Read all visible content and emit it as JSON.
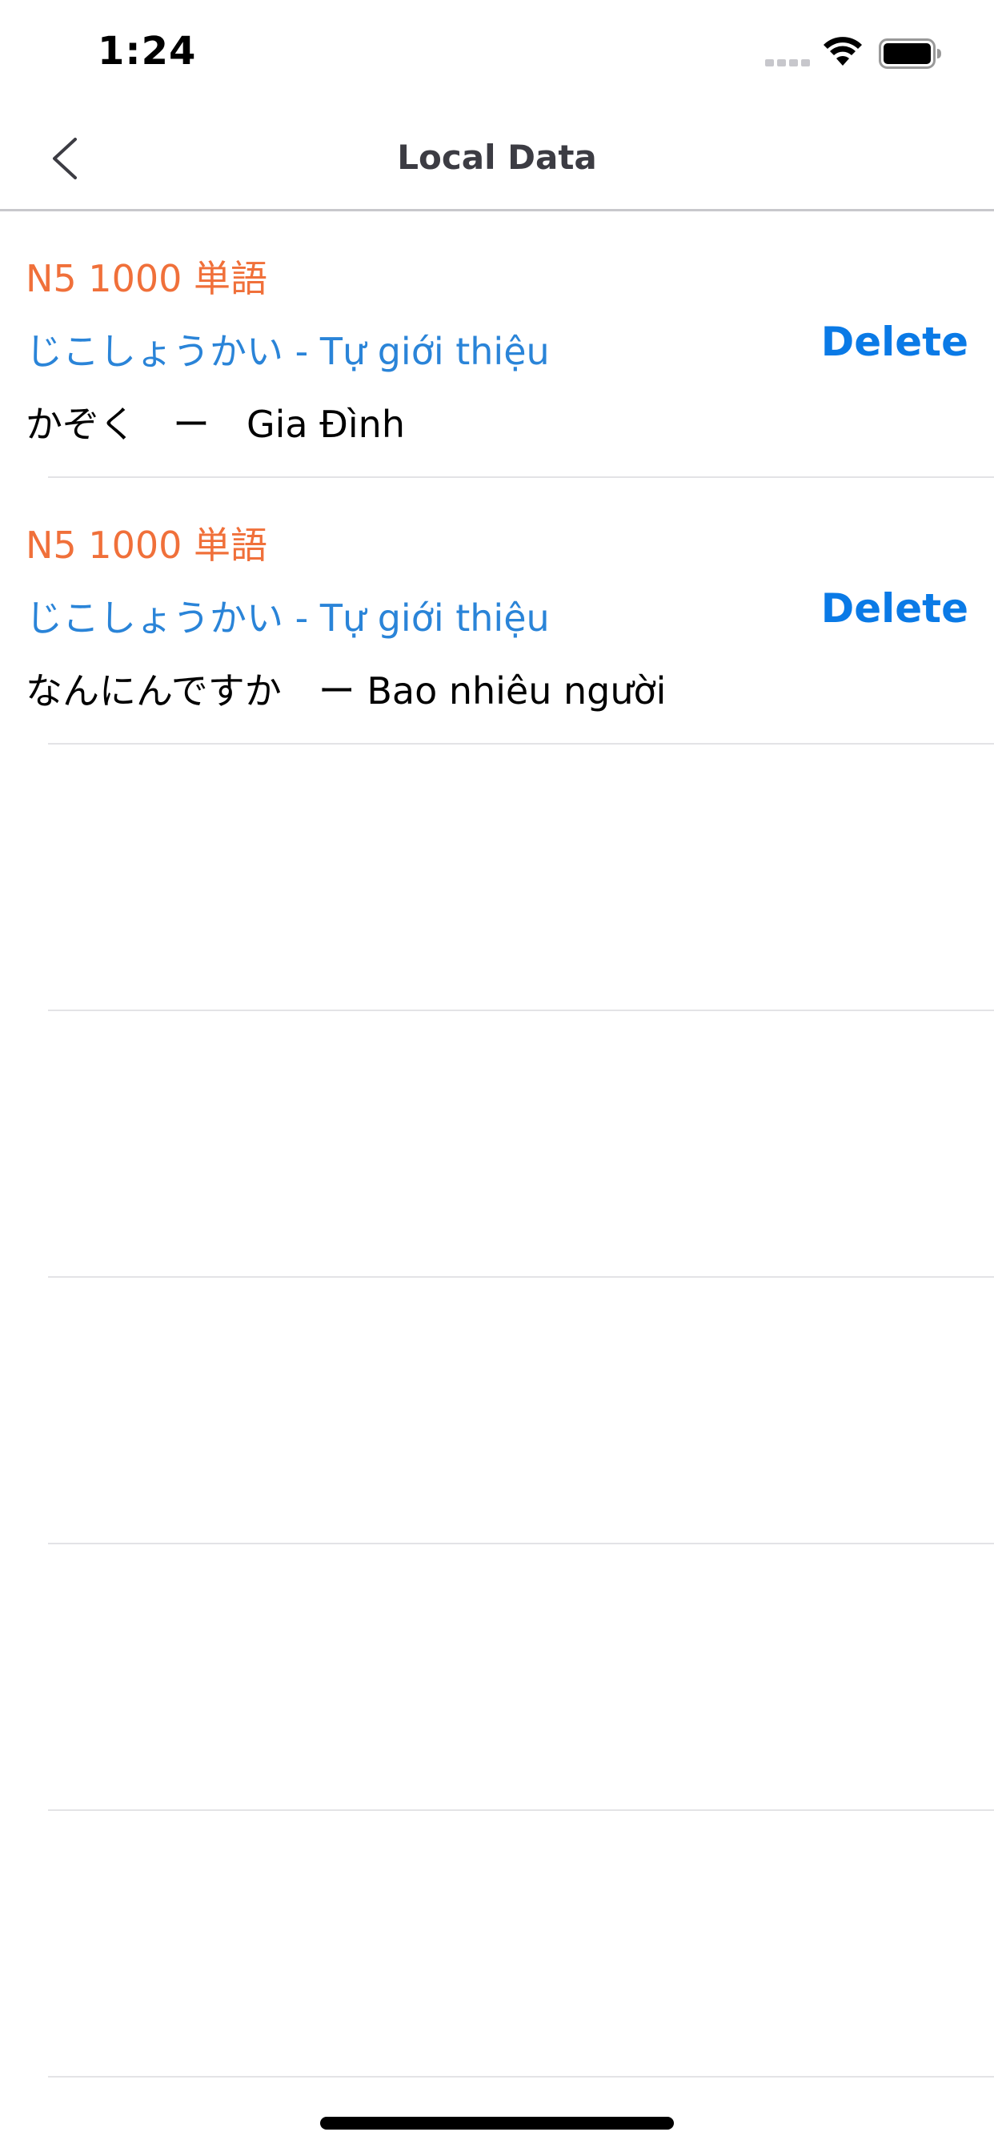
{
  "status_bar": {
    "time": "1:24"
  },
  "nav": {
    "title": "Local Data"
  },
  "rows": [
    {
      "category": "N5 1000 単語",
      "lesson": "じこしょうかい - Tự giới thiệu",
      "word": "かぞく　ー　Gia Đình",
      "delete_label": "Delete"
    },
    {
      "category": "N5 1000 単語",
      "lesson": "じこしょうかい - Tự giới thiệu",
      "word": "なんにんですか　ー Bao nhiêu người",
      "delete_label": "Delete"
    }
  ],
  "colors": {
    "category": "#f0703a",
    "lesson": "#2a84d8",
    "delete": "#0a7ae6"
  }
}
